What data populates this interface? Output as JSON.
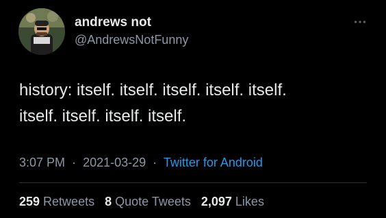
{
  "author": {
    "display_name": "andrews not",
    "handle": "@AndrewsNotFunny",
    "avatar_icon": "profile-avatar"
  },
  "tweet": {
    "text": "history: itself. itself. itself. itself. itself.\nitself. itself. itself. itself."
  },
  "meta": {
    "time": "3:07 PM",
    "date": "2021-03-29",
    "separator": "·",
    "source": "Twitter for Android"
  },
  "stats": {
    "retweets_count": "259",
    "retweets_label": "Retweets",
    "quote_count": "8",
    "quote_label": "Quote Tweets",
    "likes_count": "2,097",
    "likes_label": "Likes"
  },
  "colors": {
    "background": "#000000",
    "primary_text": "#e7e9ea",
    "secondary_text": "#8b98a5",
    "link": "#1d9bf0",
    "divider": "#2f3336"
  },
  "icons": {
    "more": "more-horizontal-icon"
  }
}
